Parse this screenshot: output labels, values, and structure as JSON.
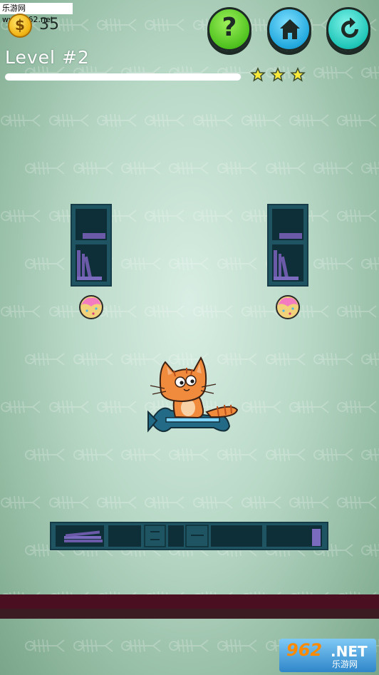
{
  "watermark": {
    "top_text": "乐游网 www.962.net",
    "bottom_big": "962",
    "bottom_net": ".NET",
    "bottom_cn": "乐游网"
  },
  "hud": {
    "coins": "35",
    "coin_symbol": "$",
    "help_label": "?",
    "level_label": "Level #2",
    "progress": 1.0,
    "stars_earned": 3
  },
  "icons": {
    "coin": "coin-icon",
    "help": "question-mark-icon",
    "home": "home-icon",
    "restart": "restart-icon",
    "star": "star-icon"
  },
  "colors": {
    "help_button": "#4fc21f",
    "home_button": "#22a8dd",
    "restart_button": "#1fc6b8",
    "star": "#f7e93c",
    "shelf": "#1f5462",
    "floor": "#4a0f20",
    "cat": "#f08a3c"
  }
}
